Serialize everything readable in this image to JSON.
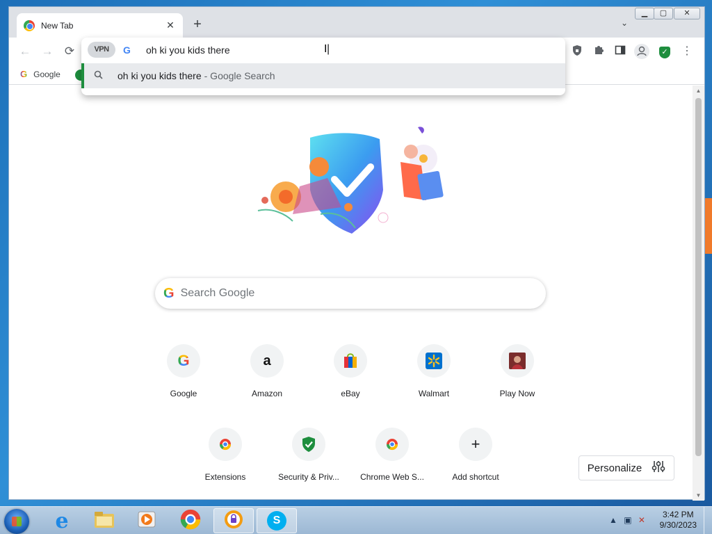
{
  "browser": {
    "tab_title": "New Tab",
    "tab_close": "✕",
    "new_tab": "+",
    "tab_search": "⌄"
  },
  "window_controls": {
    "minimize": "▁",
    "maximize": "▢",
    "close": "✕"
  },
  "toolbar": {
    "back": "←",
    "forward": "→",
    "reload": "⟳",
    "menu": "⋮"
  },
  "omnibox": {
    "badge": "VPN",
    "engine_icon": "G",
    "typed_text": "oh ki you kids there ",
    "suggestion_query": "oh ki you kids there",
    "suggestion_suffix": "- Google Search"
  },
  "bookmarks": [
    {
      "label": "Google"
    }
  ],
  "search": {
    "placeholder": "Search Google"
  },
  "shortcuts_row1": [
    {
      "label": "Google",
      "icon": "google-icon"
    },
    {
      "label": "Amazon",
      "icon": "amazon-icon"
    },
    {
      "label": "eBay",
      "icon": "ebay-icon"
    },
    {
      "label": "Walmart",
      "icon": "walmart-icon"
    },
    {
      "label": "Play Now",
      "icon": "game-icon"
    }
  ],
  "shortcuts_row2": [
    {
      "label": "Extensions",
      "icon": "chrome-icon"
    },
    {
      "label": "Security & Priv...",
      "icon": "shield-check-icon"
    },
    {
      "label": "Chrome Web S...",
      "icon": "chrome-icon"
    },
    {
      "label": "Add shortcut",
      "icon": "plus-icon"
    }
  ],
  "personalize": {
    "label": "Personalize"
  },
  "taskbar": {
    "apps": [
      {
        "name": "internet-explorer",
        "glyph": "e"
      },
      {
        "name": "file-explorer",
        "glyph": ""
      },
      {
        "name": "media-player",
        "glyph": "▶"
      },
      {
        "name": "chrome",
        "glyph": ""
      },
      {
        "name": "avast-secure-browser",
        "glyph": ""
      },
      {
        "name": "skype",
        "glyph": "S"
      }
    ],
    "time": "3:42 PM",
    "date": "9/30/2023"
  },
  "colors": {
    "accent_green": "#1e8e3e",
    "google_blue": "#4285f4",
    "taskbar": "#b9cfe4"
  }
}
